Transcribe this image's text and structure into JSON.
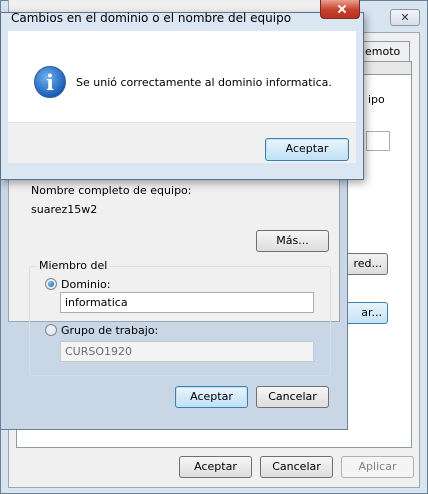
{
  "back_window": {
    "tab_fragment": "emoto",
    "text_fragment": "ipo",
    "button_fragment_1": "red...",
    "button_fragment_2": "ar...",
    "ok_label": "Aceptar",
    "cancel_label": "Cancelar",
    "apply_label": "Aplicar"
  },
  "change_dialog": {
    "full_name_label": "Nombre completo de equipo:",
    "full_name_value": "suarez15w2",
    "more_label": "Más...",
    "member_of_label": "Miembro del",
    "domain_label": "Dominio:",
    "domain_value": "informatica",
    "workgroup_label": "Grupo de trabajo:",
    "workgroup_value": "CURSO1920",
    "selected_option": "domain",
    "ok_label": "Aceptar",
    "cancel_label": "Cancelar"
  },
  "message_box": {
    "title": "Cambios en el dominio o el nombre del equipo",
    "icon": "info-icon",
    "message": "Se unió correctamente al dominio informatica.",
    "ok_label": "Aceptar"
  },
  "colors": {
    "title_bar": "#dbe6f3",
    "close_button": "#c6402c",
    "default_button_border": "#3c7fb1"
  }
}
